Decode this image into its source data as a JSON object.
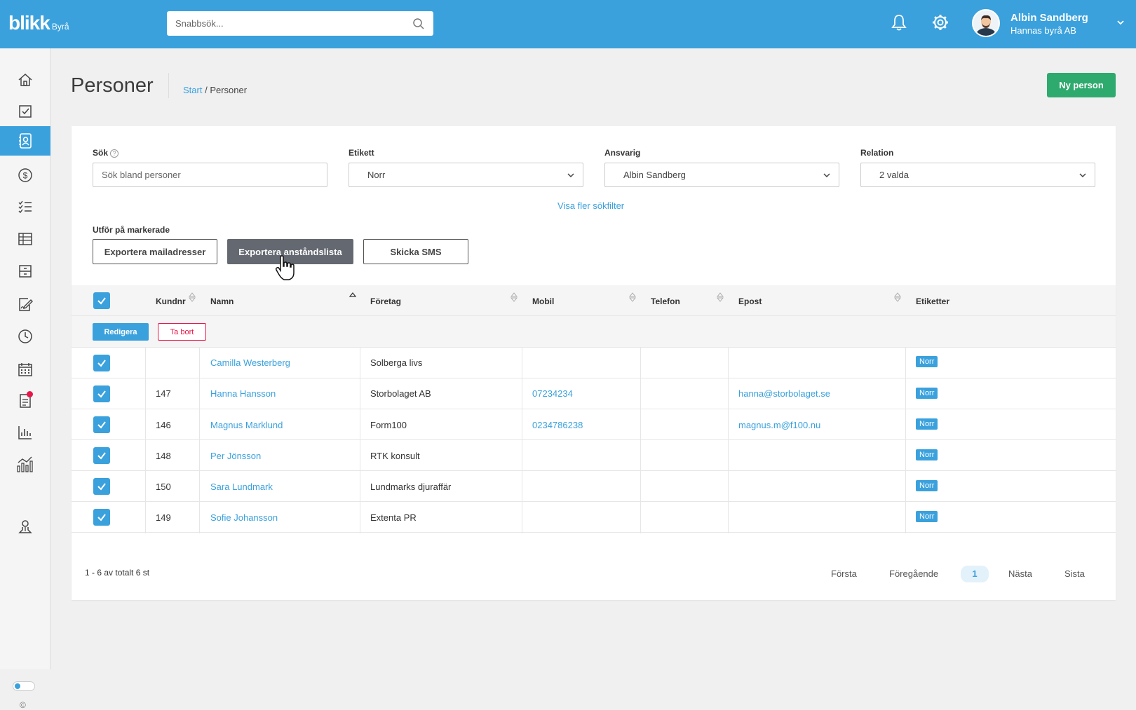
{
  "app": {
    "logo": "blikk",
    "logo_sub": "Byrå"
  },
  "search": {
    "placeholder": "Snabbsök..."
  },
  "user": {
    "name": "Albin Sandberg",
    "company": "Hannas byrå AB"
  },
  "page": {
    "title": "Personer",
    "breadcrumb_root": "Start",
    "breadcrumb_sep": " / ",
    "breadcrumb_current": "Personer",
    "new_button": "Ny person"
  },
  "filters": {
    "search_label": "Sök",
    "search_placeholder": "Sök bland personer",
    "etikett_label": "Etikett",
    "etikett_value": "Norr",
    "ansvarig_label": "Ansvarig",
    "ansvarig_value": "Albin Sandberg",
    "relation_label": "Relation",
    "relation_value": "2 valda",
    "more_filters": "Visa fler sökfilter"
  },
  "actions": {
    "label": "Utför på markerade",
    "export_mail": "Exportera mailadresser",
    "export_distance": "Exportera anståndslista",
    "send_sms": "Skicka SMS"
  },
  "table": {
    "headers": {
      "kundnr": "Kundnr",
      "namn": "Namn",
      "foretag": "Företag",
      "mobil": "Mobil",
      "telefon": "Telefon",
      "epost": "Epost",
      "etiketter": "Etiketter"
    },
    "edit_button": "Redigera",
    "delete_button": "Ta bort",
    "rows": [
      {
        "kundnr": "",
        "namn": "Camilla Westerberg",
        "foretag": "Solberga livs",
        "mobil": "",
        "telefon": "",
        "epost": "",
        "etikett": "Norr"
      },
      {
        "kundnr": "147",
        "namn": "Hanna Hansson",
        "foretag": "Storbolaget AB",
        "mobil": "07234234",
        "telefon": "",
        "epost": "hanna@storbolaget.se",
        "etikett": "Norr"
      },
      {
        "kundnr": "146",
        "namn": "Magnus Marklund",
        "foretag": "Form100",
        "mobil": "0234786238",
        "telefon": "",
        "epost": "magnus.m@f100.nu",
        "etikett": "Norr"
      },
      {
        "kundnr": "148",
        "namn": "Per Jönsson",
        "foretag": "RTK konsult",
        "mobil": "",
        "telefon": "",
        "epost": "",
        "etikett": "Norr"
      },
      {
        "kundnr": "150",
        "namn": "Sara Lundmark",
        "foretag": "Lundmarks djuraffär",
        "mobil": "",
        "telefon": "",
        "epost": "",
        "etikett": "Norr"
      },
      {
        "kundnr": "149",
        "namn": "Sofie Johansson",
        "foretag": "Extenta PR",
        "mobil": "",
        "telefon": "",
        "epost": "",
        "etikett": "Norr"
      }
    ]
  },
  "pagination": {
    "info": "1 - 6 av totalt 6 st",
    "first": "Första",
    "prev": "Föregående",
    "current": "1",
    "next": "Nästa",
    "last": "Sista"
  },
  "footer": {
    "copyright": "©"
  },
  "colors": {
    "primary": "#3aa1dd",
    "success": "#2faa6e",
    "danger": "#e8174a"
  },
  "sidebar": {
    "icons": [
      "home-icon",
      "checkbox-icon",
      "contacts-icon",
      "dollar-icon",
      "checklist-icon",
      "table-icon",
      "archive-icon",
      "sign-icon",
      "clock-icon",
      "calendar-icon",
      "document-icon",
      "bar-chart-icon",
      "analytics-icon",
      "person-icon"
    ]
  }
}
